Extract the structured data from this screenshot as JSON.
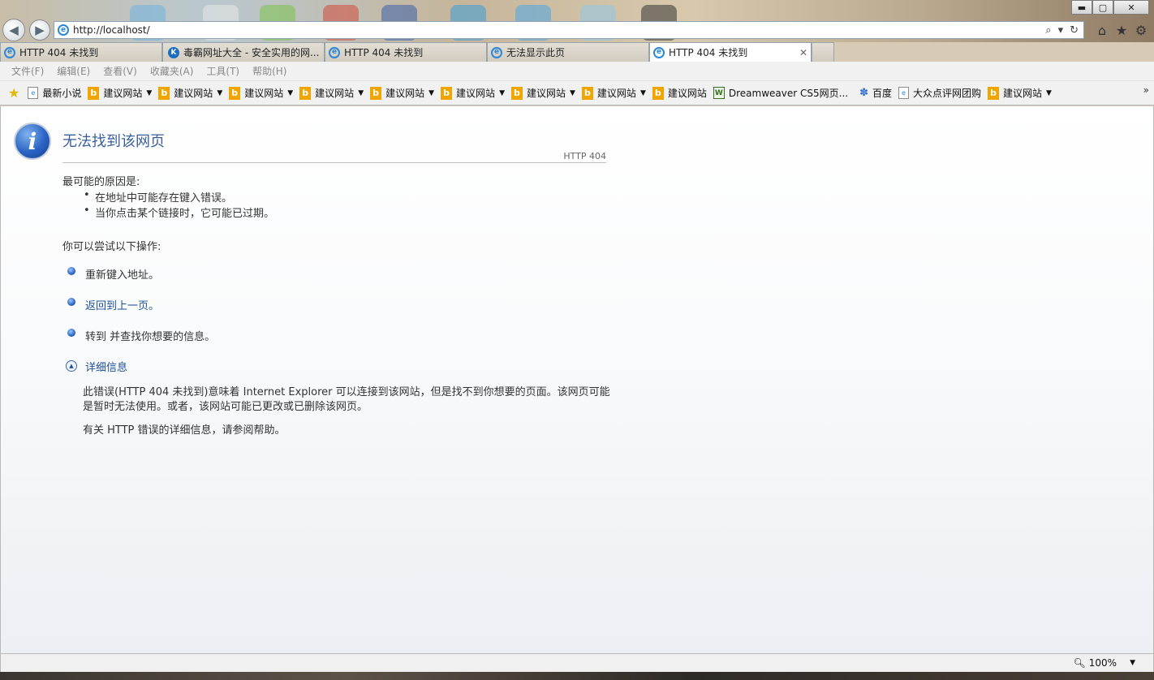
{
  "window": {
    "minimize_label": "▬",
    "maximize_label": "▢",
    "close_label": "✕"
  },
  "address": {
    "url": "http://localhost/"
  },
  "tabs": [
    {
      "label": "HTTP 404 未找到",
      "icon": "ie-icon",
      "active": false
    },
    {
      "label": "毒霸网址大全 - 安全实用的网...",
      "icon": "kingsoft-icon",
      "active": false
    },
    {
      "label": "HTTP 404 未找到",
      "icon": "ie-icon",
      "active": false
    },
    {
      "label": "无法显示此页",
      "icon": "ie-icon",
      "active": false
    },
    {
      "label": "HTTP 404 未找到",
      "icon": "ie-icon",
      "active": true
    }
  ],
  "menu": {
    "items": [
      "文件(F)",
      "编辑(E)",
      "查看(V)",
      "收藏夹(A)",
      "工具(T)",
      "帮助(H)"
    ]
  },
  "favorites": {
    "items": [
      {
        "label": "最新小说",
        "icon": "page-icon",
        "dropdown": false
      },
      {
        "label": "建议网站",
        "icon": "bing-icon",
        "dropdown": true
      },
      {
        "label": "建议网站",
        "icon": "bing-icon",
        "dropdown": true
      },
      {
        "label": "建议网站",
        "icon": "bing-icon",
        "dropdown": true
      },
      {
        "label": "建议网站",
        "icon": "bing-icon",
        "dropdown": true
      },
      {
        "label": "建议网站",
        "icon": "bing-icon",
        "dropdown": true
      },
      {
        "label": "建议网站",
        "icon": "bing-icon",
        "dropdown": true
      },
      {
        "label": "建议网站",
        "icon": "bing-icon",
        "dropdown": true
      },
      {
        "label": "建议网站",
        "icon": "bing-icon",
        "dropdown": true
      },
      {
        "label": "建议网站",
        "icon": "bing-icon",
        "dropdown": false
      },
      {
        "label": "Dreamweaver CS5网页...",
        "icon": "dreamweaver-icon",
        "dropdown": false
      },
      {
        "label": "百度",
        "icon": "baidu-paw-icon",
        "dropdown": false
      },
      {
        "label": "大众点评网团购",
        "icon": "page-icon",
        "dropdown": false
      },
      {
        "label": "建议网站",
        "icon": "bing-icon",
        "dropdown": true
      }
    ],
    "more_label": "»"
  },
  "error_page": {
    "title": "无法找到该网页",
    "http_code": "HTTP 404",
    "causes_heading": "最可能的原因是:",
    "causes": [
      "在地址中可能存在键入错误。",
      "当你点击某个链接时，它可能已过期。"
    ],
    "actions_heading": "你可以尝试以下操作:",
    "actions": [
      {
        "label": "重新键入地址。",
        "is_link": false
      },
      {
        "label": "返回到上一页。",
        "is_link": true
      },
      {
        "label": "转到  并查找你想要的信息。",
        "is_link": false
      }
    ],
    "details_label": "详细信息",
    "details_line1": "此错误(HTTP 404 未找到)意味着 Internet Explorer 可以连接到该网站，但是找不到你想要的页面。该网页可能",
    "details_line2": "是暂时无法使用。或者，该网站可能已更改或已删除该网页。",
    "help_text": "有关 HTTP 错误的详细信息，请参阅帮助。"
  },
  "status": {
    "zoom_label": "100%"
  },
  "colors": {
    "title_blue": "#3b5f9b",
    "link_blue": "#1f4f9a",
    "bing_orange": "#f0a500"
  }
}
